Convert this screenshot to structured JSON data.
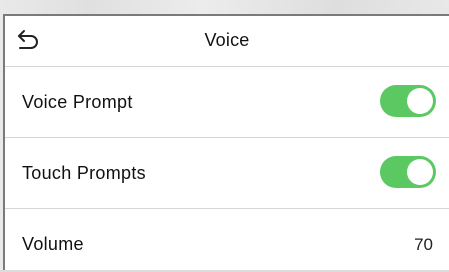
{
  "header": {
    "title": "Voice",
    "back_icon": "back-arrow-icon"
  },
  "settings": [
    {
      "label": "Voice Prompt",
      "control": "toggle",
      "on": true
    },
    {
      "label": "Touch Prompts",
      "control": "toggle",
      "on": true
    },
    {
      "label": "Volume",
      "control": "value",
      "value": "70"
    }
  ],
  "colors": {
    "toggle_on": "#5bc862",
    "background": "#ffffff",
    "divider": "#d6d6d6",
    "text": "#111111"
  }
}
